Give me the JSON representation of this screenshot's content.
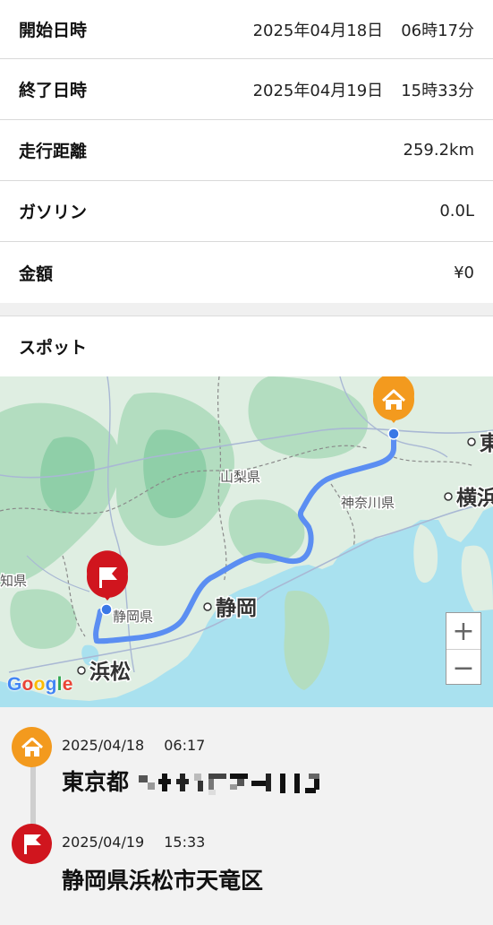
{
  "info": {
    "start": {
      "label": "開始日時",
      "date": "2025年04月18日",
      "time": "06時17分"
    },
    "end": {
      "label": "終了日時",
      "date": "2025年04月19日",
      "time": "15時33分"
    },
    "distance": {
      "label": "走行距離",
      "value": "259.2km"
    },
    "gasoline": {
      "label": "ガソリン",
      "value": "0.0L"
    },
    "amount": {
      "label": "金額",
      "value": "¥0"
    }
  },
  "spot": {
    "title": "スポット",
    "map": {
      "labels": {
        "yamanashi": "山梨県",
        "kanagawa": "神奈川県",
        "shizuoka_pref": "静岡県",
        "shizuoka_city": "静岡",
        "hamamatsu": "浜松",
        "yokohama": "横浜",
        "tokyo_partial": "東",
        "aichi_partial": "知県"
      },
      "zoom_in": "+",
      "zoom_out": "−",
      "attribution": "Google"
    },
    "colors": {
      "route": "#5b8ef2",
      "start_marker": "#f39a1e",
      "end_marker": "#d0151e",
      "water": "#a9e1ef",
      "land": "#dfeee2"
    }
  },
  "timeline": [
    {
      "icon": "home-icon",
      "date": "2025/04/18",
      "time": "06:17",
      "address": "東京都"
    },
    {
      "icon": "flag-icon",
      "date": "2025/04/19",
      "time": "15:33",
      "address": "静岡県浜松市天竜区"
    }
  ]
}
